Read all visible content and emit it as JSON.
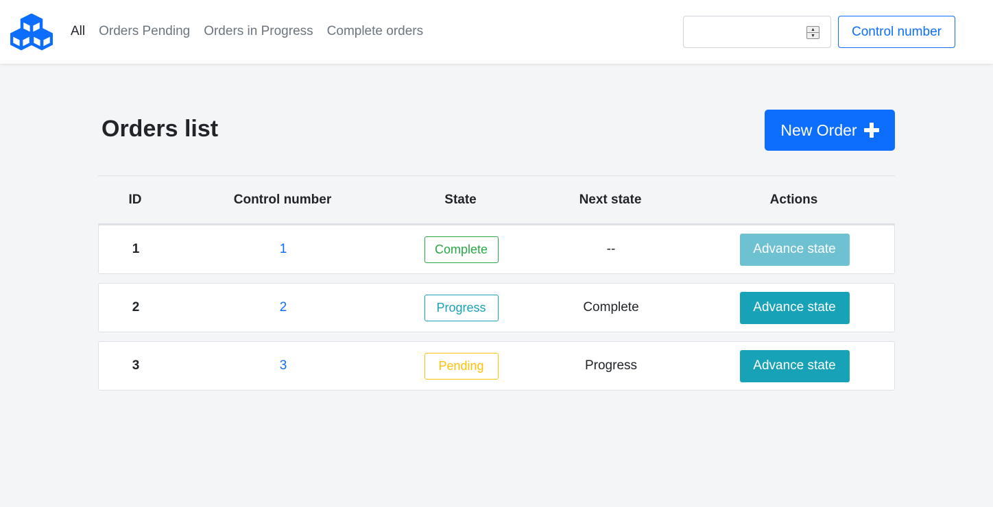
{
  "nav": {
    "links": [
      "All",
      "Orders Pending",
      "Orders in Progress",
      "Complete orders"
    ],
    "search_value": "",
    "search_button": "Control number"
  },
  "page": {
    "title": "Orders list",
    "new_order_label": "New Order"
  },
  "table": {
    "headers": [
      "ID",
      "Control number",
      "State",
      "Next state",
      "Actions"
    ],
    "rows": [
      {
        "id": "1",
        "control": "1",
        "state": "Complete",
        "state_color": "#28a745",
        "next": "--",
        "action": "Advance state",
        "action_disabled": true
      },
      {
        "id": "2",
        "control": "2",
        "state": "Progress",
        "state_color": "#17a2b8",
        "next": "Complete",
        "action": "Advance state",
        "action_disabled": false
      },
      {
        "id": "3",
        "control": "3",
        "state": "Pending",
        "state_color": "#ffc107",
        "next": "Progress",
        "action": "Advance state",
        "action_disabled": false
      }
    ]
  },
  "colors": {
    "primary": "#0d6efd",
    "info": "#17a2b8",
    "success": "#28a745",
    "warning": "#ffc107"
  },
  "icons": {
    "logo": "cubes-icon",
    "new_order": "plus-icon",
    "spinner": "spinner-arrows-icon"
  }
}
